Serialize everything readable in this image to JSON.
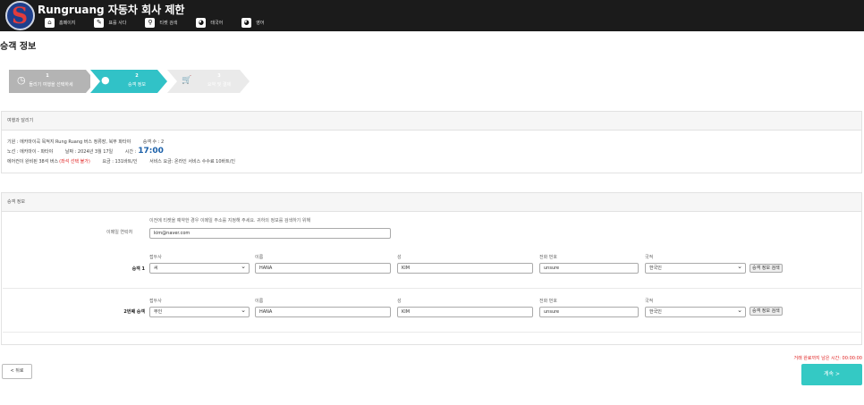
{
  "header": {
    "site_title": "Rungruang 자동차 회사 제한",
    "logo_letter": "S",
    "nav": [
      {
        "label": "홈페이지",
        "icon": "home-icon",
        "glyph": "⌂"
      },
      {
        "label": "표를 사다",
        "icon": "ticket-icon",
        "glyph": "✎"
      },
      {
        "label": "티켓 검색",
        "icon": "search-icon",
        "glyph": "⚲"
      },
      {
        "label": "태국어",
        "icon": "globe-icon",
        "glyph": "◕"
      },
      {
        "label": "영어",
        "icon": "globe-icon",
        "glyph": "◕"
      }
    ]
  },
  "page_title": "승객 정보",
  "steps": [
    {
      "num": "1",
      "label": "돌리기 여행을 선택하세",
      "icon": "clock-icon",
      "glyph": "◷"
    },
    {
      "num": "2",
      "label": "승객 정보",
      "icon": "user-icon",
      "glyph": "●"
    },
    {
      "num": "3",
      "label": "요약 및 결제",
      "icon": "cart-icon",
      "glyph": "🛒"
    }
  ],
  "trip": {
    "heading": "여행과 달리기",
    "origin": "기원 : 에카마이곡 목적지 Rung Ruang 버스 정류장, 북부 파타야",
    "passenger_count": "승객 수 : 2",
    "route": "노선 : 에카마이 - 파타야",
    "date": "날짜 : 2024년 3월 17일",
    "time_label": "시간 :",
    "time_value": "17:00",
    "bus_type": "에어컨이 완비된 38석 버스",
    "seat_note": "(좌석 선택 불가)",
    "fare": "요금 : 131바트/인",
    "service_fee": "서비스 요금: 온라인 서비스 수수료 10바트/인"
  },
  "passengers_panel": {
    "heading": "승객 정보",
    "email_hint": "이전에 티켓을 예약한 경우 이메일 주소를 지정해 주세요. 귀하의 정보를 검색하기 위해",
    "email_label": "이메일 연락처",
    "email_value": "kim@naver.com",
    "col_title": "접두사",
    "col_first": "이름",
    "col_last": "성",
    "col_phone": "전화 번호",
    "col_nation": "국적",
    "search_btn": "승객 정보 검색",
    "rows": [
      {
        "label": "승객 1",
        "prefix": "씨",
        "first": "HANA",
        "last": "KIM",
        "phone": "unsure",
        "nation": "한국인"
      },
      {
        "label": "2번째 승객",
        "prefix": "부인",
        "first": "HANA",
        "last": "KIM",
        "phone": "unsure",
        "nation": "한국인"
      }
    ]
  },
  "footer": {
    "back": "< 뒤로",
    "timer_label": "거래 완료까지 남은 시간:",
    "timer_value": "00:00:00",
    "next": "계속 >"
  }
}
